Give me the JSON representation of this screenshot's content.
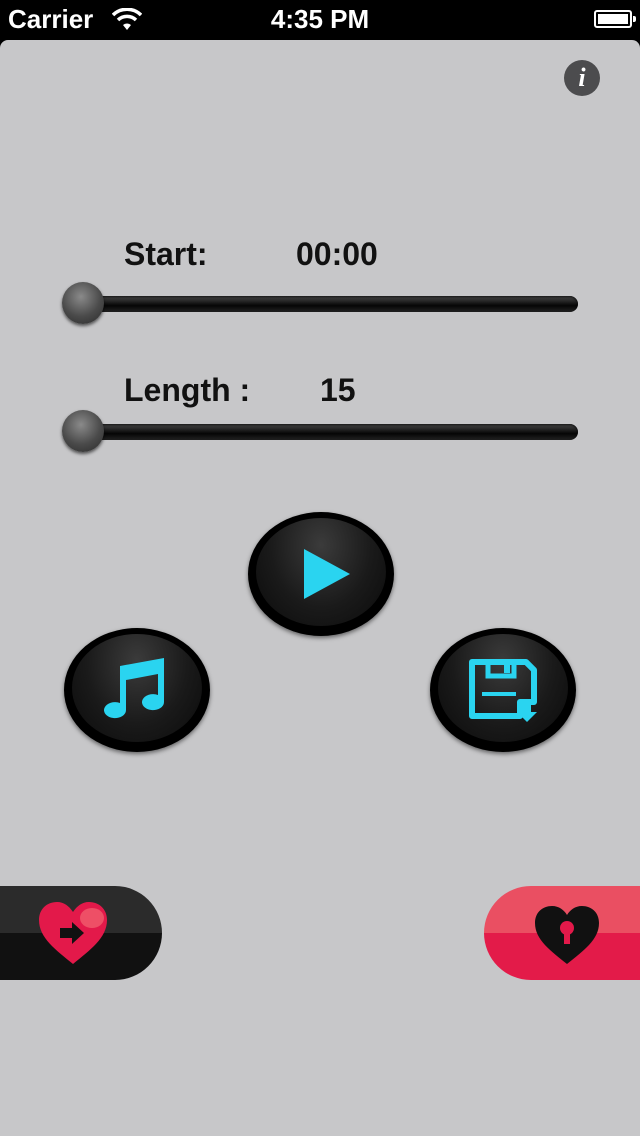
{
  "status_bar": {
    "carrier": "Carrier",
    "time": "4:35 PM"
  },
  "start": {
    "label": "Start:",
    "value": "00:00",
    "slider_fraction": 0.0
  },
  "length": {
    "label": "Length :",
    "value": "15",
    "slider_fraction": 0.0
  },
  "icons": {
    "info": "info-icon",
    "play": "play-icon",
    "music": "music-note-icon",
    "save": "save-download-icon",
    "favorite_move": "heart-arrow-icon",
    "favorite_lock": "heart-lock-icon"
  },
  "colors": {
    "accent": "#2ad4f0",
    "heart_red": "#e3194a",
    "background": "#c7c7c9"
  }
}
